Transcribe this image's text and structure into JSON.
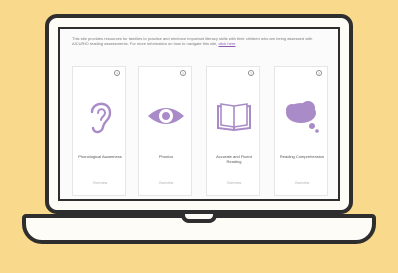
{
  "intro": {
    "text": "This site provides resources for families to practice and reinforce important literacy skills with their children who are being assessed with AICURIO reading assessments. For more information on how to navigate this site,",
    "link": "click here"
  },
  "cards": [
    {
      "label": "Phonological Awareness",
      "overview": "Overview",
      "icon": "ear-icon"
    },
    {
      "label": "Phonics",
      "overview": "Overview",
      "icon": "eye-icon"
    },
    {
      "label": "Accurate and Fluent Reading",
      "overview": "Overview",
      "icon": "book-icon"
    },
    {
      "label": "Reading Comprehension",
      "overview": "Overview",
      "icon": "thought-bubble-icon"
    }
  ],
  "help_glyph": "?",
  "colors": {
    "accent": "#a98bc7",
    "background": "#f9d98c",
    "frame": "#2e2e2e"
  }
}
